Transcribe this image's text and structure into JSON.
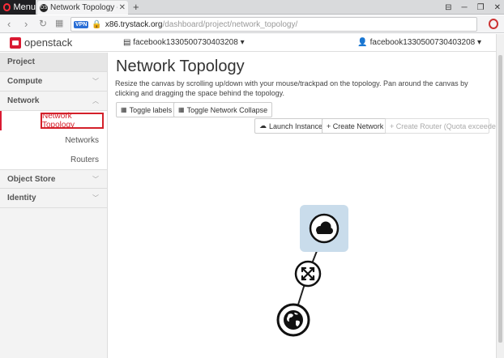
{
  "browser": {
    "menu_label": "Menu",
    "tab_title": "Network Topology - Ope",
    "tab_favicon_text": "OS",
    "new_tab": "+",
    "vpn_badge": "VPN",
    "url_domain": "x86.trystack.org",
    "url_path": "/dashboard/project/network_topology/"
  },
  "header": {
    "logo_text": "openstack",
    "project_selector": "facebook1330500730403208 ▾",
    "user_selector": "facebook1330500730403208 ▾"
  },
  "sidebar": {
    "project": "Project",
    "compute": "Compute",
    "network": "Network",
    "network_topology": "Network Topology",
    "networks": "Networks",
    "routers": "Routers",
    "object_store": "Object Store",
    "identity": "Identity"
  },
  "main": {
    "title": "Network Topology",
    "description": "Resize the canvas by scrolling up/down with your mouse/trackpad on the topology. Pan around the canvas by clicking and dragging the space behind the topology.",
    "toggle_labels": "Toggle labels",
    "toggle_collapse": "Toggle Network Collapse",
    "launch_instance": "Launch Instance",
    "create_network": "+ Create Network",
    "create_router": "+ Create Router (Quota exceeded)"
  },
  "icons": {
    "cloud": "cloud-icon",
    "router": "router-icon",
    "globe": "globe-icon"
  },
  "colors": {
    "brand_red": "#da1a32",
    "selected_node_bg": "#c9dceb"
  }
}
